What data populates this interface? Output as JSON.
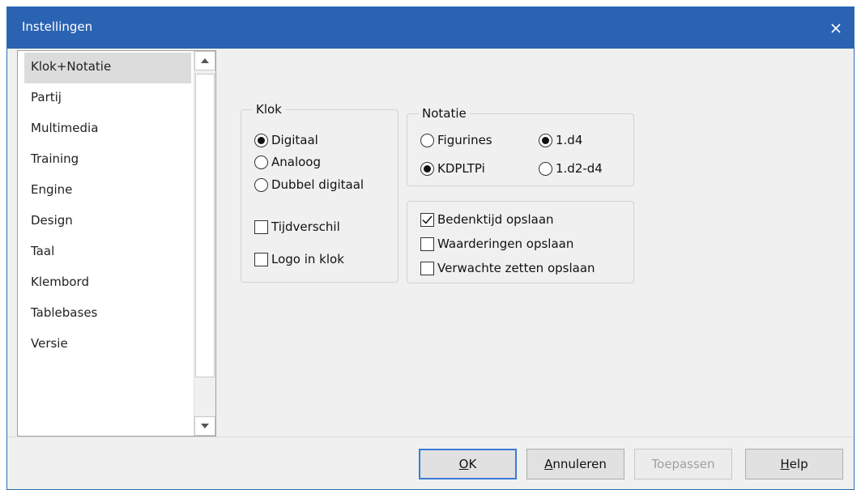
{
  "window": {
    "title": "Instellingen"
  },
  "sidebar": {
    "items": [
      {
        "label": "Klok+Notatie"
      },
      {
        "label": "Partij"
      },
      {
        "label": "Multimedia"
      },
      {
        "label": "Training"
      },
      {
        "label": "Engine"
      },
      {
        "label": "Design"
      },
      {
        "label": "Taal"
      },
      {
        "label": "Klembord"
      },
      {
        "label": "Tablebases"
      },
      {
        "label": "Versie"
      }
    ],
    "selected": "Klok+Notatie"
  },
  "klok": {
    "legend": "Klok",
    "options": [
      {
        "label": "Digitaal",
        "selected": true
      },
      {
        "label": "Analoog",
        "selected": false
      },
      {
        "label": "Dubbel digitaal",
        "selected": false
      }
    ],
    "tijdverschil": {
      "label": "Tijdverschil",
      "checked": false
    },
    "logo": {
      "label": "Logo in klok",
      "checked": false
    }
  },
  "notatie": {
    "legend": "Notatie",
    "figurines": {
      "label": "Figurines",
      "selected": false
    },
    "kdpltpi": {
      "label": "KDPLTPi",
      "selected": true
    },
    "d4": {
      "label": "1.d4",
      "selected": true
    },
    "d2d4": {
      "label": "1.d2-d4",
      "selected": false
    }
  },
  "opslaan": {
    "bedenktijd": {
      "label": "Bedenktijd opslaan",
      "checked": true
    },
    "waarderingen": {
      "label": "Waarderingen opslaan",
      "checked": false
    },
    "verwachte": {
      "label": "Verwachte zetten opslaan",
      "checked": false
    }
  },
  "buttons": {
    "ok": {
      "mnemonic": "O",
      "rest": "K"
    },
    "cancel": {
      "mnemonic": "A",
      "rest": "nnuleren"
    },
    "apply": "Toepassen",
    "help": {
      "mnemonic": "H",
      "rest": "elp"
    }
  },
  "colors": {
    "titlebar": "#2b63b3",
    "dialog_bg": "#f0f0f0",
    "default_button_border": "#3a7bd5"
  }
}
